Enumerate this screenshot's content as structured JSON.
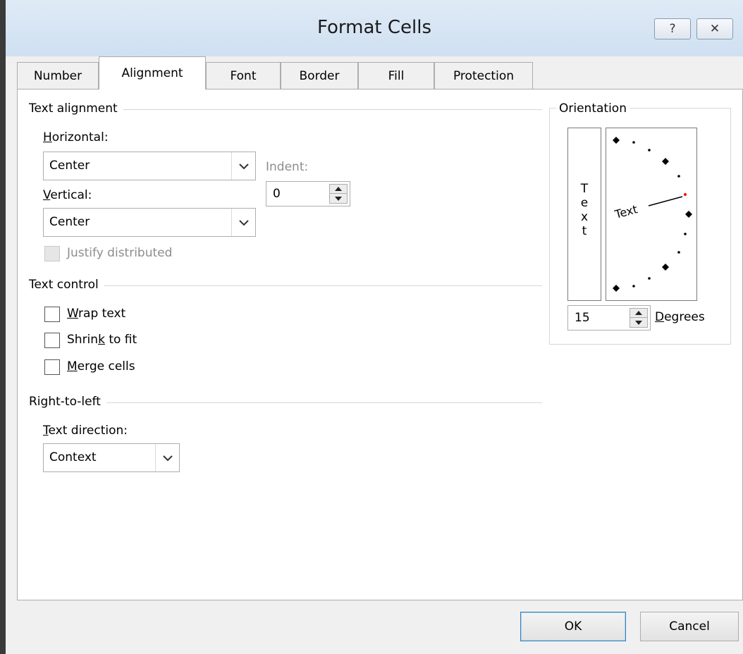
{
  "window": {
    "title": "Format Cells",
    "help_label": "?",
    "close_label": "✕"
  },
  "tabs": [
    {
      "label": "Number",
      "active": false
    },
    {
      "label": "Alignment",
      "active": true
    },
    {
      "label": "Font",
      "active": false
    },
    {
      "label": "Border",
      "active": false
    },
    {
      "label": "Fill",
      "active": false
    },
    {
      "label": "Protection",
      "active": false
    }
  ],
  "text_alignment": {
    "group_label": "Text alignment",
    "horizontal": {
      "label_access": "H",
      "label_rest": "orizontal:",
      "value": "Center"
    },
    "vertical": {
      "label_access": "V",
      "label_rest": "ertical:",
      "value": "Center"
    },
    "indent": {
      "label": "Indent:",
      "value": "0"
    },
    "justify_distributed": {
      "label": "Justify distributed",
      "checked": false,
      "enabled": false
    }
  },
  "text_control": {
    "group_label": "Text control",
    "wrap_text": {
      "label_access": "W",
      "label_rest": "rap text",
      "checked": false
    },
    "shrink_to_fit": {
      "label_pre": "Shrin",
      "label_access": "k",
      "label_rest": " to fit",
      "checked": false
    },
    "merge_cells": {
      "label_access": "M",
      "label_rest": "erge cells",
      "checked": false
    }
  },
  "right_to_left": {
    "group_label": "Right-to-left",
    "text_direction": {
      "label_access": "T",
      "label_rest": "ext direction:",
      "value": "Context"
    }
  },
  "orientation": {
    "group_label": "Orientation",
    "vertical_letters": [
      "T",
      "e",
      "x",
      "t"
    ],
    "dial_text": "Text",
    "degrees_value": "15",
    "degrees_label_access": "D",
    "degrees_label_rest": "egrees",
    "pointer_color": "#ff0000"
  },
  "buttons": {
    "ok": "OK",
    "cancel": "Cancel"
  }
}
